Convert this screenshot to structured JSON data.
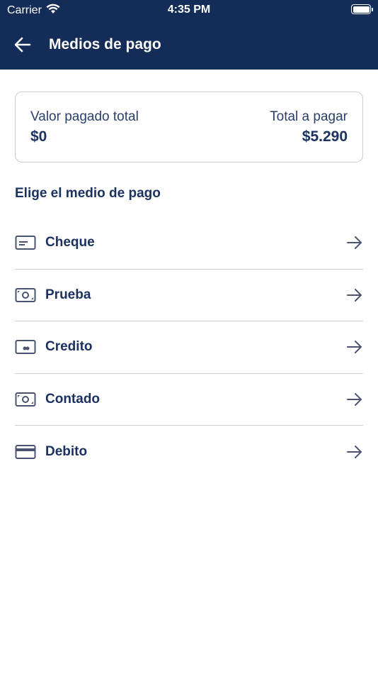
{
  "status": {
    "carrier": "Carrier",
    "time": "4:35 PM"
  },
  "header": {
    "title": "Medios de pago",
    "back_icon": "arrow-left-icon"
  },
  "summary": {
    "paid_label": "Valor pagado total",
    "paid_value": "$0",
    "total_label": "Total a pagar",
    "total_value": "$5.290"
  },
  "section_title": "Elige el medio de pago",
  "methods": [
    {
      "label": "Cheque",
      "icon": "cheque-icon"
    },
    {
      "label": "Prueba",
      "icon": "cash-icon"
    },
    {
      "label": "Credito",
      "icon": "wallet-icon"
    },
    {
      "label": "Contado",
      "icon": "cash-icon"
    },
    {
      "label": "Debito",
      "icon": "card-icon"
    }
  ],
  "colors": {
    "header_bg": "#142c58",
    "text_primary": "#1b3160",
    "divider": "#c9ccd6",
    "arrow": "#4a5470"
  }
}
